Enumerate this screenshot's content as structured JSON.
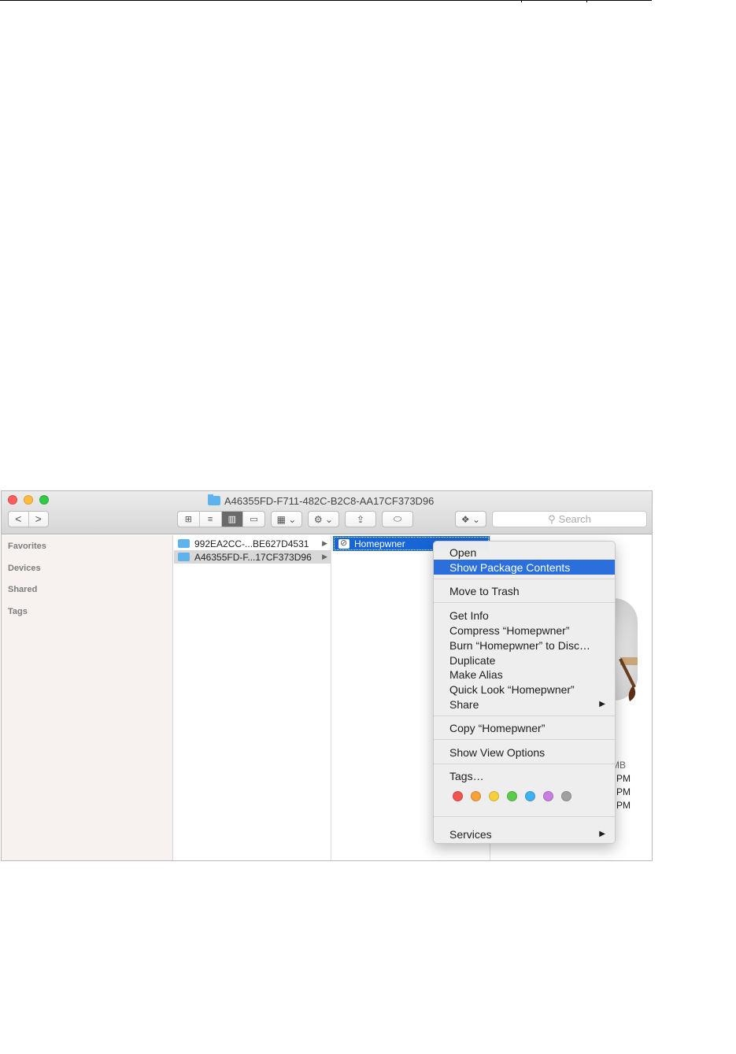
{
  "window": {
    "title": "A46355FD-F711-482C-B2C8-AA17CF373D96",
    "back_label": "<",
    "forward_label": ">",
    "view_icons": [
      "⊞",
      "≡",
      "▥",
      "▭"
    ],
    "arrange_label": "▦ ⌄",
    "action_label": "⚙ ⌄",
    "share_label": "⇪",
    "tag_label": "⬭",
    "dropbox_label": "❖ ⌄",
    "search_placeholder": "Search",
    "search_glyph": "⚲"
  },
  "sidebar": {
    "sections": [
      "Favorites",
      "Devices",
      "Shared",
      "Tags"
    ]
  },
  "columns": {
    "col1": [
      {
        "name": "992EA2CC-...BE627D4531"
      },
      {
        "name": "A46355FD-F...17CF373D96"
      }
    ],
    "col2": [
      {
        "name": "Homepwner"
      }
    ],
    "arrow": "▶"
  },
  "preview": {
    "size_suffix": "MB",
    "time_suffixes": [
      "PM",
      "PM",
      "PM"
    ]
  },
  "context_menu": {
    "open": "Open",
    "show_package": "Show Package Contents",
    "move_trash": "Move to Trash",
    "get_info": "Get Info",
    "compress": "Compress “Homepwner”",
    "burn": "Burn “Homepwner” to Disc…",
    "duplicate": "Duplicate",
    "make_alias": "Make Alias",
    "quick_look": "Quick Look “Homepwner”",
    "share": "Share",
    "copy": "Copy “Homepwner”",
    "view_options": "Show View Options",
    "tags": "Tags…",
    "services": "Services",
    "submenu_arrow": "▶",
    "tag_colors": [
      "#f05450",
      "#f7a33a",
      "#f5cf3c",
      "#5dcb4a",
      "#3fb0f2",
      "#c67ee0",
      "#a0a0a0"
    ]
  }
}
